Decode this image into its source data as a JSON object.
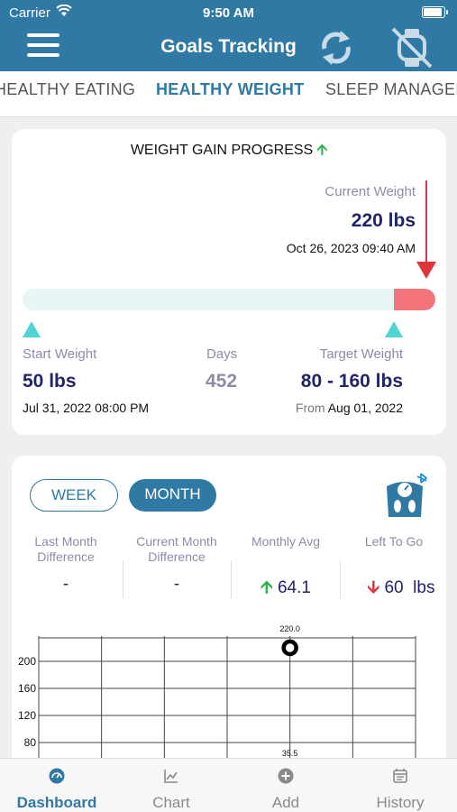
{
  "status_bar": {
    "carrier": "Carrier",
    "time": "9:50 AM"
  },
  "header": {
    "title": "Goals Tracking",
    "icons": [
      "menu-icon",
      "sync-icon",
      "watch-disabled-icon"
    ]
  },
  "tabs": [
    {
      "label": "HEALTHY EATING",
      "active": false
    },
    {
      "label": "HEALTHY WEIGHT",
      "active": true
    },
    {
      "label": "SLEEP MANAGEMENT",
      "active": false
    }
  ],
  "progress": {
    "title": "WEIGHT GAIN PROGRESS",
    "current_label": "Current Weight",
    "current_value": "220 lbs",
    "current_date": "Oct 26, 2023 09:40 AM",
    "start_label": "Start Weight",
    "start_value": "50 lbs",
    "start_date": "Jul 31, 2022 08:00 PM",
    "days_label": "Days",
    "days_value": "452",
    "target_label": "Target Weight",
    "target_value": "80 - 160 lbs",
    "target_from": "From",
    "target_date": "Aug 01, 2022",
    "colors": {
      "track": "#e5f6f4",
      "over_target": "#f2737a",
      "marker": "#4fd6d3",
      "current_arrow": "#e0343a"
    }
  },
  "stats": {
    "week_label": "WEEK",
    "month_label": "MONTH",
    "selected": "MONTH",
    "headers": [
      "Last Month Difference",
      "Current Month Difference",
      "Monthly Avg",
      "Left To Go"
    ],
    "headers_split": [
      [
        "Last Month",
        "Difference"
      ],
      [
        "Current Month",
        "Difference"
      ],
      [
        "Monthly Avg",
        ""
      ],
      [
        "Left To Go",
        ""
      ]
    ],
    "last_month_diff": "-",
    "current_month_diff": "-",
    "monthly_avg": "64.1",
    "left_to_go": "60",
    "left_to_go_unit": "lbs"
  },
  "chart_data": {
    "type": "scatter",
    "y_ticks": [
      200,
      160,
      120,
      80
    ],
    "ylim": [
      60,
      230
    ],
    "points": [
      {
        "x": 4,
        "y": 220.0,
        "label": "220.0"
      }
    ],
    "bottom_label": "35.5",
    "grid": true
  },
  "bottom_nav": [
    {
      "label": "Dashboard",
      "icon": "dashboard-icon",
      "active": true
    },
    {
      "label": "Chart",
      "icon": "chart-icon",
      "active": false
    },
    {
      "label": "Add",
      "icon": "add-icon",
      "active": false
    },
    {
      "label": "History",
      "icon": "history-icon",
      "active": false
    }
  ]
}
